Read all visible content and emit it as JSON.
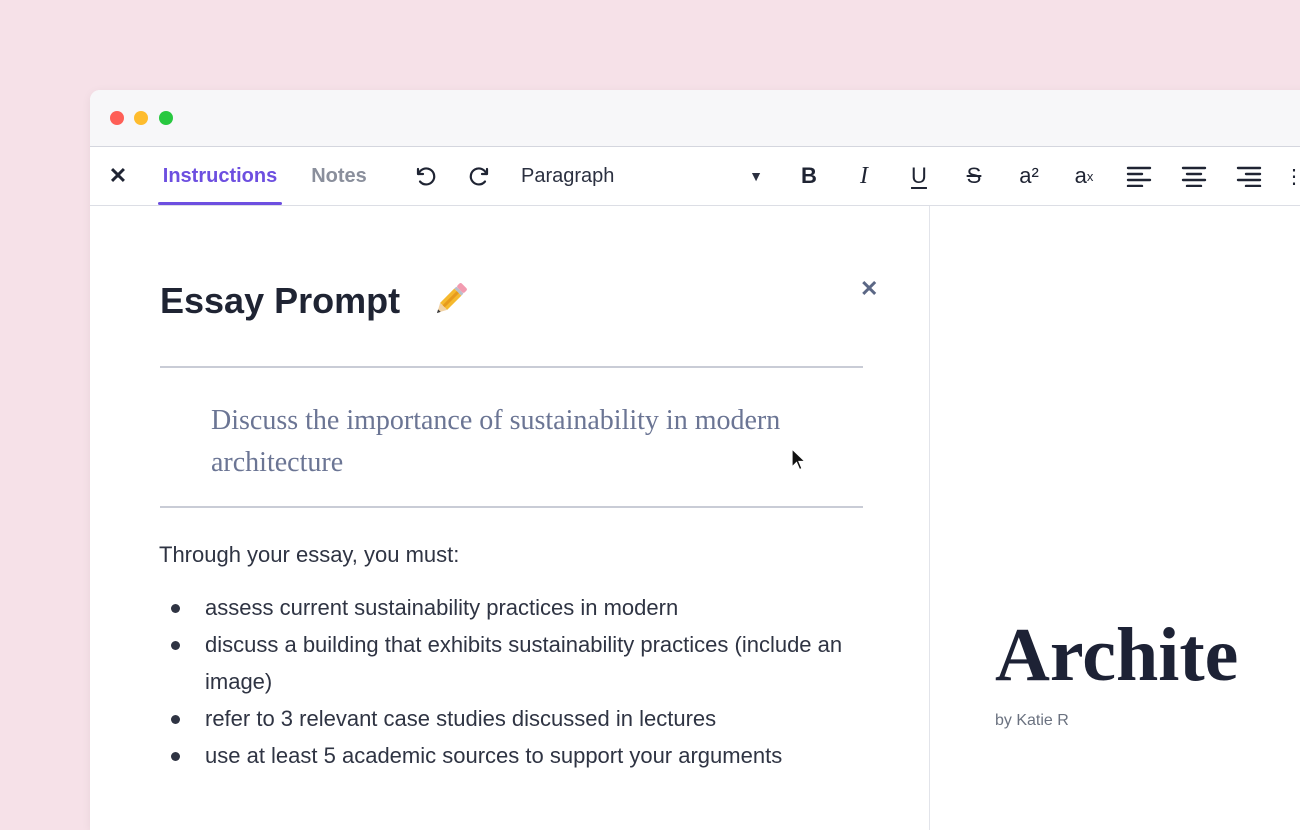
{
  "toolbar": {
    "close": "✕",
    "tabs": [
      {
        "label": "Instructions",
        "active": true
      },
      {
        "label": "Notes",
        "active": false
      }
    ],
    "block_style": "Paragraph",
    "format_buttons": {
      "bold": "B",
      "italic": "I",
      "underline": "U",
      "strikethrough": "S",
      "superscript": "a²",
      "subscript_base": "a",
      "subscript_mark": "x"
    }
  },
  "panel": {
    "title": "Essay Prompt",
    "close": "✕",
    "prompt": "Discuss the importance of sustainability in modern architecture",
    "intro": "Through your essay, you must:",
    "requirements": [
      "assess current sustainability practices in modern",
      "discuss a building that exhibits sustainability practices (include an image)",
      "refer to 3 relevant case studies discussed in lectures",
      "use at least 5 academic sources to support your arguments"
    ]
  },
  "document": {
    "title": "Archite",
    "byline": "by Katie R"
  },
  "colors": {
    "accent": "#6d4fe0",
    "background": "#f6e1e8",
    "prompt_text": "#6b7594"
  },
  "icons": {
    "undo": "undo-icon",
    "redo": "redo-icon",
    "pencil": "pencil-icon",
    "align_left": "align-left-icon",
    "align_center": "align-center-icon",
    "align_right": "align-right-icon"
  }
}
